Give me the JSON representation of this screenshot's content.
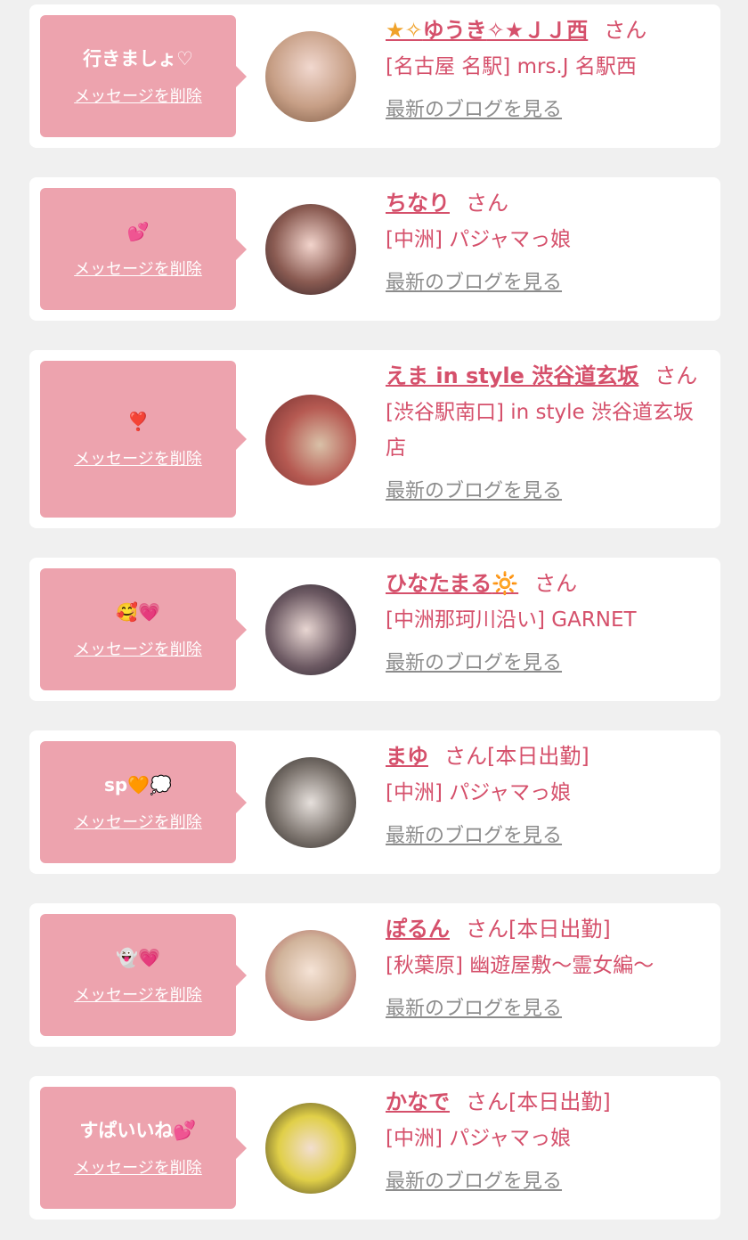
{
  "delete_label": "メッセージを削除",
  "blog_label": "最新のブログを見る",
  "colors": {
    "background": "#f0f0f0",
    "card": "#ffffff",
    "bubble": "#eda3ae",
    "accent": "#d5506b",
    "muted": "#8c8c8c"
  },
  "items": [
    {
      "message": "行きましょ♡",
      "name_prefix": "★✧",
      "name": "ゆうき",
      "name_suffix": "✧★ＪＪ西",
      "honorific": "さん",
      "status": "",
      "shop": "[名古屋 名駅] mrs.J 名駅西",
      "avatar_icon": "avatar-photo"
    },
    {
      "message": "💕",
      "name_prefix": "",
      "name": "ちなり",
      "name_suffix": "",
      "honorific": "さん",
      "status": "",
      "shop": "[中洲] パジャマっ娘",
      "avatar_icon": "avatar-photo"
    },
    {
      "message": "❣️",
      "name_prefix": "",
      "name": "えま in style 渋谷道玄坂",
      "name_suffix": "",
      "honorific": "さん",
      "status": "",
      "shop": "[渋谷駅南口] in style 渋谷道玄坂店",
      "avatar_icon": "avatar-photo"
    },
    {
      "message": "🥰💗",
      "name_prefix": "",
      "name": "ひなたまる",
      "name_suffix": "🔆",
      "honorific": "さん",
      "status": "",
      "shop": "[中洲那珂川沿い] GARNET",
      "avatar_icon": "avatar-photo"
    },
    {
      "message": "sp🧡💭",
      "name_prefix": "",
      "name": "まゆ",
      "name_suffix": "",
      "honorific": "さん",
      "status": "[本日出勤]",
      "shop": "[中洲] パジャマっ娘",
      "avatar_icon": "avatar-photo"
    },
    {
      "message": "👻💗",
      "name_prefix": "",
      "name": "ぽるん",
      "name_suffix": "",
      "honorific": "さん",
      "status": "[本日出勤]",
      "shop": "[秋葉原] 幽遊屋敷～霊女編～",
      "avatar_icon": "avatar-photo"
    },
    {
      "message": "すぱいいね💕",
      "name_prefix": "",
      "name": "かなで",
      "name_suffix": "",
      "honorific": "さん",
      "status": "[本日出勤]",
      "shop": "[中洲] パジャマっ娘",
      "avatar_icon": "avatar-photo"
    }
  ]
}
